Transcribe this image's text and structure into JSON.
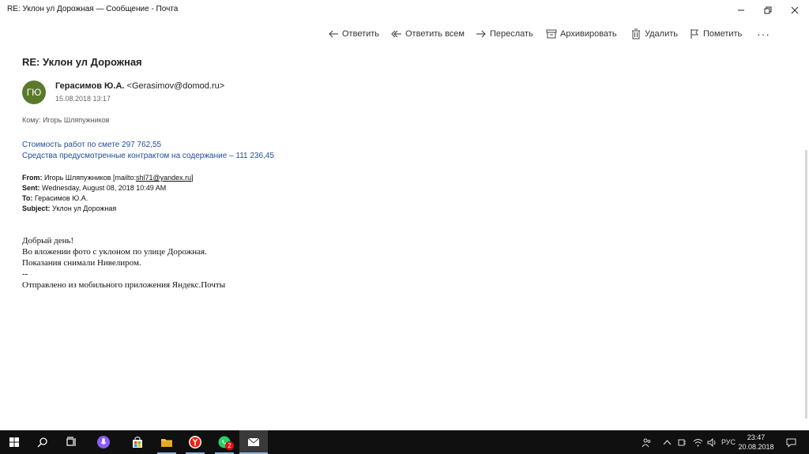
{
  "window": {
    "title": "RE: Уклон ул Дорожная — Сообщение - Почта"
  },
  "toolbar": {
    "reply": "Ответить",
    "reply_all": "Ответить всем",
    "forward": "Переслать",
    "archive": "Архивировать",
    "delete": "Удалить",
    "flag": "Пометить",
    "more": "···"
  },
  "message": {
    "subject": "RE: Уклон ул Дорожная",
    "avatar_initials": "ГЮ",
    "avatar_color": "#5a7a2b",
    "sender_name": "Герасимов Ю.А.",
    "sender_email": "<Gerasimov@domod.ru>",
    "date": "15.08.2018 13:17",
    "to_label": "Кому:",
    "to_value": "Игорь Шляпужников",
    "blue_lines": [
      "Стоимость работ по смете  297 762,55",
      "Средства предусмотренные контрактом на содержание – 111 236,45"
    ],
    "quoted_header": {
      "from_label": "From:",
      "from_value": "Игорь Шляпужников [mailto:",
      "from_email": "shl71@yandex.ru",
      "from_end": "]",
      "sent_label": "Sent:",
      "sent_value": "Wednesday, August 08, 2018 10:49 AM",
      "to_label": "To:",
      "to_value": "Герасимов Ю.А.",
      "subject_label": "Subject:",
      "subject_value": "Уклон ул Дорожная"
    },
    "body_lines": [
      "Добрый день!",
      "Во вложении фото с уклоном по улице Дорожная.",
      "Показания снимали Нивелиром.",
      "--",
      "Отправлено из мобильного приложения Яндекс.Почты"
    ]
  },
  "taskbar": {
    "whatsapp_badge": "2",
    "language": "РУС",
    "time": "23:47",
    "date": "20.08.2018"
  },
  "colors": {
    "accent_link": "#1f4e9c",
    "taskbar_bg": "#101010"
  }
}
